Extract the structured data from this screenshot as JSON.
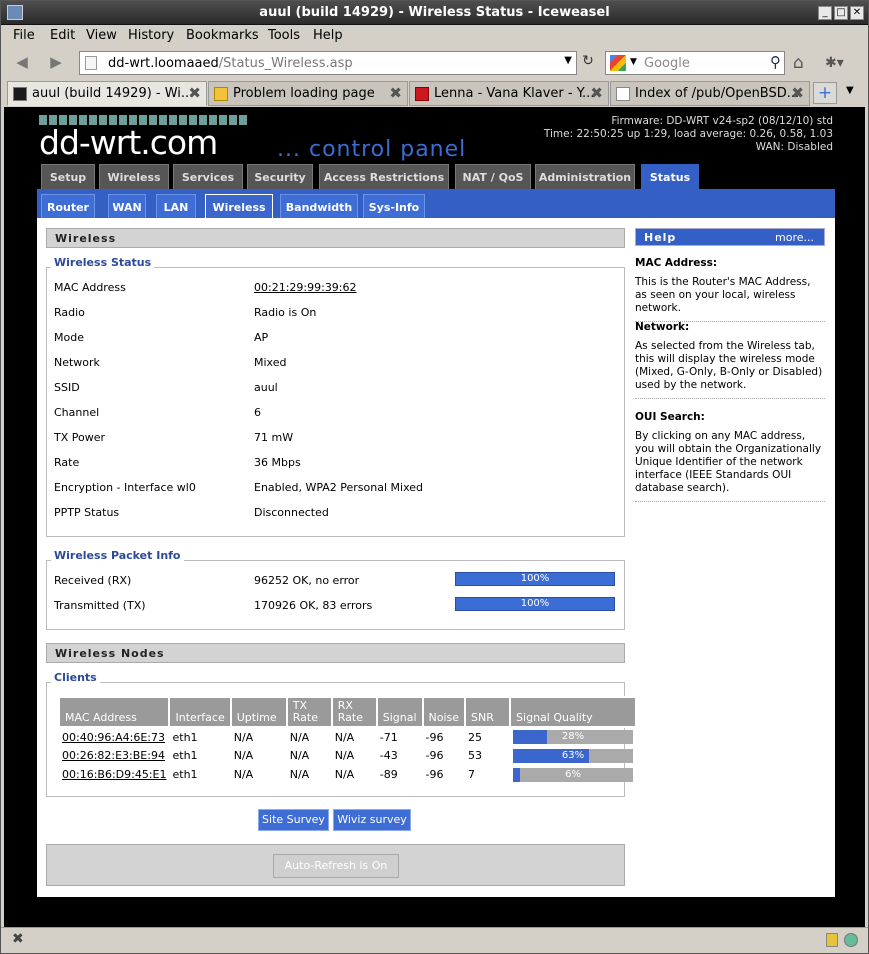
{
  "window": {
    "title": "auul (build 14929) - Wireless Status - Iceweasel"
  },
  "menu": [
    "File",
    "Edit",
    "View",
    "History",
    "Bookmarks",
    "Tools",
    "Help"
  ],
  "url": {
    "host": "dd-wrt.loomaaed",
    "path": "/Status_Wireless.asp"
  },
  "search": {
    "placeholder": "Google"
  },
  "tabs": [
    {
      "label": "auul (build 14929) - Wi...",
      "close": "✖"
    },
    {
      "label": "Problem loading page",
      "close": "✖"
    },
    {
      "label": "Lenna - Vana Klaver - Y...",
      "close": "✖"
    },
    {
      "label": "Index of /pub/OpenBSD...",
      "close": "✖"
    }
  ],
  "header": {
    "logo": "dd-wrt.com",
    "panel": "... control panel",
    "firmware": "Firmware: DD-WRT v24-sp2 (08/12/10) std",
    "time": "Time: 22:50:25 up 1:29, load average: 0.26, 0.58, 1.03",
    "wan": "WAN: Disabled"
  },
  "main_tabs": [
    "Setup",
    "Wireless",
    "Services",
    "Security",
    "Access Restrictions",
    "NAT / QoS",
    "Administration",
    "Status"
  ],
  "sub_tabs": [
    "Router",
    "WAN",
    "LAN",
    "Wireless",
    "Bandwidth",
    "Sys-Info"
  ],
  "wireless": {
    "section": "Wireless",
    "legend": "Wireless Status",
    "rows": [
      {
        "label": "MAC Address",
        "value": "00:21:29:99:39:62"
      },
      {
        "label": "Radio",
        "value": "Radio is On"
      },
      {
        "label": "Mode",
        "value": "AP"
      },
      {
        "label": "Network",
        "value": "Mixed"
      },
      {
        "label": "SSID",
        "value": "auul"
      },
      {
        "label": "Channel",
        "value": "6"
      },
      {
        "label": "TX Power",
        "value": "71 mW"
      },
      {
        "label": "Rate",
        "value": "36 Mbps"
      },
      {
        "label": "Encryption - Interface wl0",
        "value": "Enabled, WPA2 Personal Mixed"
      },
      {
        "label": "PPTP Status",
        "value": "Disconnected"
      }
    ]
  },
  "packet": {
    "legend": "Wireless Packet Info",
    "rows": [
      {
        "label": "Received (RX)",
        "value": "96252 OK, no error",
        "bar": "100%",
        "level": 100
      },
      {
        "label": "Transmitted (TX)",
        "value": "170926 OK, 83 errors",
        "bar": "100%",
        "level": 100
      }
    ]
  },
  "nodes": {
    "section": "Wireless Nodes",
    "legend": "Clients",
    "headers": [
      "MAC Address",
      "Interface",
      "Uptime",
      "TX Rate",
      "RX Rate",
      "Signal",
      "Noise",
      "SNR",
      "Signal Quality"
    ],
    "clients": [
      {
        "mac": "00:40:96:A4:6E:73",
        "iface": "eth1",
        "uptime": "N/A",
        "tx": "N/A",
        "rx": "N/A",
        "signal": "-71",
        "noise": "-96",
        "snr": "25",
        "quality": "28%",
        "level": 28
      },
      {
        "mac": "00:26:82:E3:BE:94",
        "iface": "eth1",
        "uptime": "N/A",
        "tx": "N/A",
        "rx": "N/A",
        "signal": "-43",
        "noise": "-96",
        "snr": "53",
        "quality": "63%",
        "level": 63
      },
      {
        "mac": "00:16:B6:D9:45:E1",
        "iface": "eth1",
        "uptime": "N/A",
        "tx": "N/A",
        "rx": "N/A",
        "signal": "-89",
        "noise": "-96",
        "snr": "7",
        "quality": "6%",
        "level": 6
      }
    ]
  },
  "buttons": {
    "site_survey": "Site Survey",
    "wiviz": "Wiviz survey",
    "auto_refresh": "Auto-Refresh is On"
  },
  "help": {
    "title": "Help",
    "more": "more...",
    "items": [
      {
        "title": "MAC Address:",
        "text": "This is the Router's MAC Address, as seen on your local, wireless network."
      },
      {
        "title": "Network:",
        "text": "As selected from the Wireless tab, this will display the wireless mode (Mixed, G-Only, B-Only or Disabled) used by the network."
      },
      {
        "title": "OUI Search:",
        "text": "By clicking on any MAC address, you will obtain the Organizationally Unique Identifier of the network interface (IEEE Standards OUI database search)."
      }
    ]
  },
  "colors": {
    "accent": "#3460c6",
    "tab_inactive": "#565656",
    "bar": "#3b6dd4"
  }
}
